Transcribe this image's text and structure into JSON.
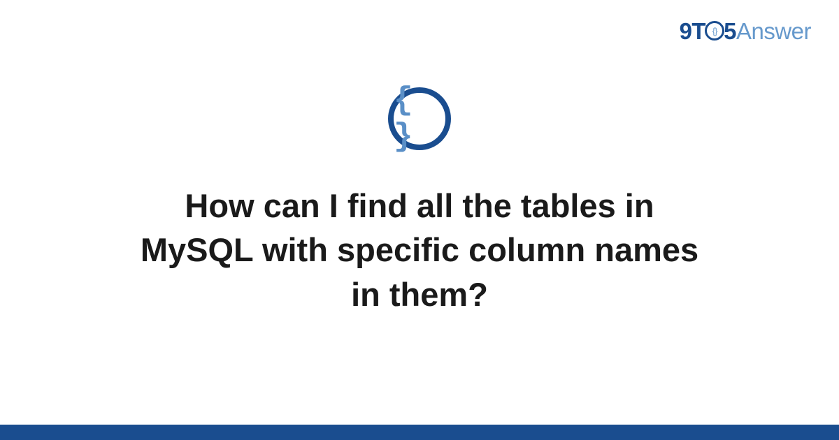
{
  "logo": {
    "part1": "9T",
    "circle_inner": "{}",
    "part2": "5",
    "part3": "Answer"
  },
  "icon": {
    "symbol": "{ }",
    "name": "code-braces"
  },
  "title": "How can I find all the tables in MySQL with specific column names in them?",
  "colors": {
    "primary": "#1a4d8f",
    "secondary": "#6699cc",
    "text": "#1a1a1a"
  }
}
